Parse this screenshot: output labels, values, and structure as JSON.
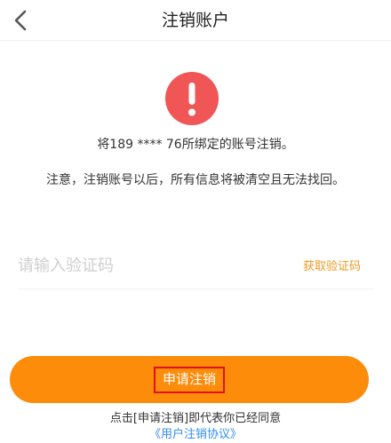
{
  "header": {
    "title": "注销账户",
    "back_icon": "chevron-left-icon"
  },
  "warning": {
    "icon": "exclamation-icon",
    "color": "#f05655",
    "phone_text": "将189 **** 76所绑定的账号注销。",
    "notice_text": "注意，注销账号以后，所有信息将被清空且无法找回。"
  },
  "verify": {
    "placeholder": "请输入验证码",
    "value": "",
    "get_code_label": "获取验证码",
    "get_code_color": "#ef9a1e"
  },
  "submit": {
    "label": "申请注销",
    "button_color": "#fd8c0b",
    "highlight_color": "#e0101c"
  },
  "agreement": {
    "text": "点击[申请注销]即代表你已经同意",
    "link_label": "《用户注销协议》",
    "link_color": "#2f8ef0"
  }
}
